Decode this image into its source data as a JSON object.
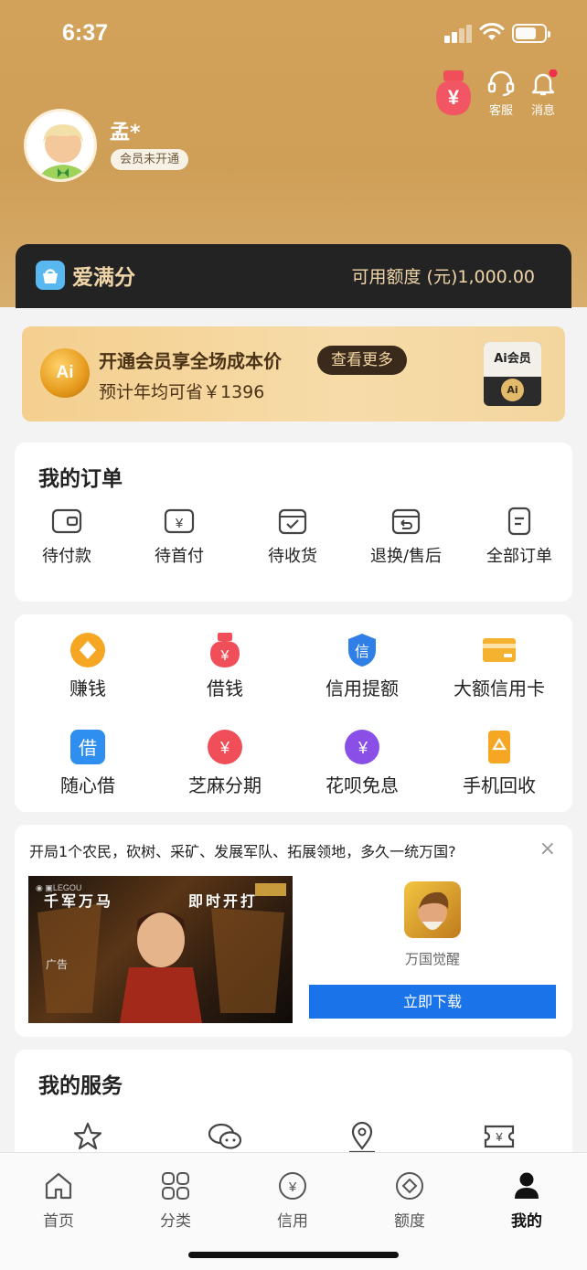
{
  "status": {
    "time": "6:37"
  },
  "header": {
    "service_label": "客服",
    "message_label": "消息"
  },
  "user": {
    "name": "孟*",
    "vip_status": "会员未开通"
  },
  "credit": {
    "brand": "爱满分",
    "available": "可用额度 (元)1,000.00"
  },
  "vip_banner": {
    "coin_text": "Ai",
    "line1": "开通会员享全场成本价",
    "more_button": "查看更多",
    "line2": "预计年均可省￥1396",
    "card_label": "Ai会员",
    "card_coin": "Ai"
  },
  "orders": {
    "title": "我的订单",
    "items": [
      {
        "label": "待付款",
        "icon": "wallet-icon"
      },
      {
        "label": "待首付",
        "icon": "yuan-icon"
      },
      {
        "label": "待收货",
        "icon": "box-icon"
      },
      {
        "label": "退换/售后",
        "icon": "return-icon"
      },
      {
        "label": "全部订单",
        "icon": "list-icon"
      }
    ]
  },
  "quick_grid": {
    "items": [
      {
        "label": "赚钱",
        "icon": "diamond-coin-icon",
        "color": "#f5a623"
      },
      {
        "label": "借钱",
        "icon": "money-bag-icon",
        "color": "#f04f5a"
      },
      {
        "label": "信用提额",
        "icon": "shield-icon",
        "color": "#2f7fe6"
      },
      {
        "label": "大额信用卡",
        "icon": "card-icon",
        "color": "#f5b230"
      },
      {
        "label": "随心借",
        "icon": "borrow-icon",
        "color": "#2f8ff0"
      },
      {
        "label": "芝麻分期",
        "icon": "yuan-circle-icon",
        "color": "#f04f5a"
      },
      {
        "label": "花呗免息",
        "icon": "huabei-icon",
        "color": "#8a4fe6"
      },
      {
        "label": "手机回收",
        "icon": "phone-recycle-icon",
        "color": "#f5a623"
      }
    ]
  },
  "ad": {
    "title": "开局1个农民，砍树、采矿、发展军队、拓展领地，多久一统万国?",
    "close": "×",
    "image_text_left": "千军万马",
    "image_text_right": "即时开打",
    "tag": "广告",
    "game_name": "万国觉醒",
    "download_button": "立即下载"
  },
  "services": {
    "title": "我的服务",
    "items": [
      {
        "icon": "star-icon"
      },
      {
        "icon": "chat-icon"
      },
      {
        "icon": "location-icon"
      },
      {
        "icon": "ticket-icon"
      }
    ]
  },
  "tabbar": {
    "items": [
      {
        "label": "首页",
        "icon": "home-icon"
      },
      {
        "label": "分类",
        "icon": "category-icon"
      },
      {
        "label": "信用",
        "icon": "credit-icon"
      },
      {
        "label": "额度",
        "icon": "quota-icon"
      },
      {
        "label": "我的",
        "icon": "profile-icon"
      }
    ]
  }
}
